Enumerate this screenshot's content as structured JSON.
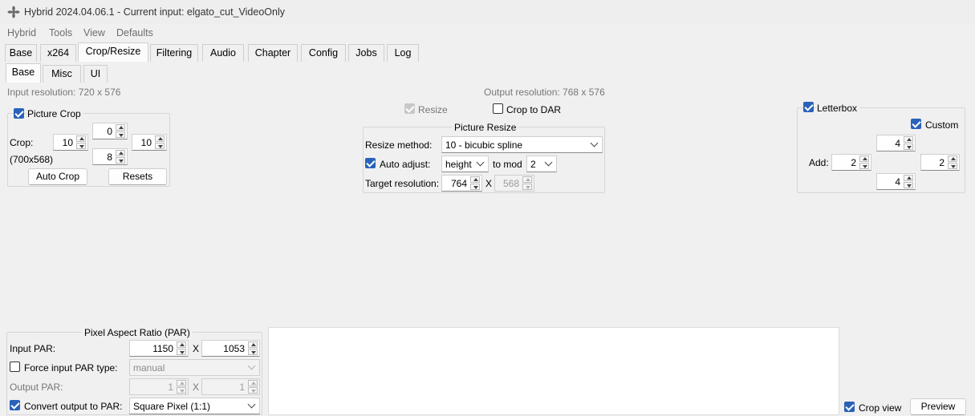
{
  "window": {
    "title": "Hybrid 2024.04.06.1 - Current input: elgato_cut_VideoOnly",
    "app_icon": "hybrid-app-icon"
  },
  "menu": [
    "Hybrid",
    "Tools",
    "View",
    "Defaults"
  ],
  "main_tabs": [
    "Base",
    "x264",
    "Crop/Resize",
    "Filtering",
    "Audio",
    "Chapter",
    "Config",
    "Jobs",
    "Log"
  ],
  "active_main_tab": "Crop/Resize",
  "sub_tabs": [
    "Base",
    "Misc",
    "UI"
  ],
  "active_sub_tab": "Base",
  "input_resolution": "Input resolution: 720 x 576",
  "output_resolution": "Output resolution: 768 x 576",
  "crop": {
    "checkbox_label": "Picture Crop",
    "enabled": true,
    "label": "Crop:",
    "dims": "(700x568)",
    "top": "0",
    "left": "10",
    "right": "10",
    "bottom": "8",
    "auto_crop": "Auto Crop",
    "resets": "Resets"
  },
  "resize": {
    "resize_label": "Resize",
    "resize_checked": true,
    "crop_to_dar_label": "Crop to DAR",
    "crop_to_dar_checked": false,
    "group_title": "Picture Resize",
    "method_label": "Resize method:",
    "method_value": "10 - bicubic spline",
    "auto_adjust_label": "Auto adjust:",
    "auto_adjust_checked": true,
    "auto_adjust_value": "height",
    "to_mod_label": "to mod",
    "mod_value": "2",
    "target_label": "Target resolution:",
    "target_width": "764",
    "x_sep": "X",
    "target_height": "568"
  },
  "letterbox": {
    "label": "Letterbox",
    "checked": true,
    "custom_label": "Custom",
    "custom_checked": true,
    "add_label": "Add:",
    "top": "4",
    "left": "2",
    "right": "2",
    "bottom": "4"
  },
  "par": {
    "group_title": "Pixel Aspect Ratio (PAR)",
    "input_label": "Input PAR:",
    "input_w": "1150",
    "x_sep": "X",
    "input_h": "1053",
    "force_label": "Force input PAR type:",
    "force_checked": false,
    "force_value": "manual",
    "output_label": "Output PAR:",
    "output_w": "1",
    "output_h": "1",
    "convert_label": "Convert output to PAR:",
    "convert_checked": true,
    "convert_value": "Square Pixel (1:1)"
  },
  "bottom": {
    "crop_view_label": "Crop view",
    "crop_view_checked": true,
    "preview_label": "Preview"
  },
  "colors": {
    "accent": "#2a62b8",
    "background": "#f0f0f0"
  }
}
